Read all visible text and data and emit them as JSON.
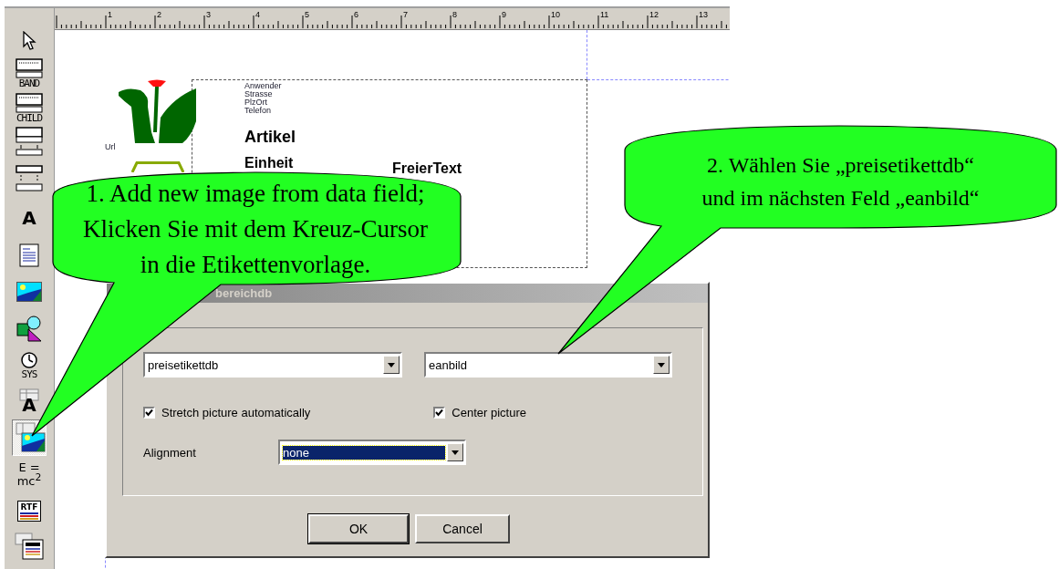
{
  "toolbar": {
    "items": [
      {
        "kind": "pointer",
        "selected": false
      },
      {
        "kind": "band",
        "label": "BAND",
        "selected": false
      },
      {
        "kind": "band",
        "label": "CHILD",
        "selected": false
      },
      {
        "kind": "band2",
        "selected": false
      },
      {
        "kind": "band3",
        "selected": false
      },
      {
        "kind": "text",
        "label": "A",
        "selected": false
      },
      {
        "kind": "memo",
        "selected": false
      },
      {
        "kind": "image",
        "selected": false
      },
      {
        "kind": "shape",
        "selected": false
      },
      {
        "kind": "sysdata",
        "label": "SYS",
        "selected": false
      },
      {
        "kind": "dbtext",
        "label": "A",
        "selected": false
      },
      {
        "kind": "dbimage",
        "selected": true
      },
      {
        "kind": "formula",
        "lines": [
          "E =",
          "mc$^{2}$"
        ],
        "selected": false
      },
      {
        "kind": "rtf",
        "label": "RTF",
        "selected": false
      },
      {
        "kind": "dbrtf",
        "selected": false
      }
    ]
  },
  "ruler": {
    "labels": [
      "1",
      "2",
      "3",
      "4",
      "5",
      "6",
      "7",
      "8",
      "9",
      "10",
      "11",
      "12",
      "13"
    ]
  },
  "label_template": {
    "address_lines": [
      "Anwender",
      "Strasse",
      "PlzOrt",
      "Telefon"
    ],
    "title": "Artikel",
    "url_label": "Url",
    "unit": "Einheit",
    "free_text": "FreierText"
  },
  "dialog": {
    "title": "bereichdb",
    "table_field": {
      "value": "preisetikettdb"
    },
    "field_field": {
      "value": "eanbild"
    },
    "options": [
      {
        "label": "Stretch picture automatically",
        "checked": true
      },
      {
        "label": "Center picture",
        "checked": true
      }
    ],
    "alignment": {
      "label": "Alignment",
      "value": "none",
      "highlighted": true
    },
    "buttons": [
      {
        "label": "OK",
        "default": true
      },
      {
        "label": "Cancel",
        "default": false
      }
    ]
  },
  "callouts": [
    {
      "lines": [
        "1. Add new image from data field;",
        "Klicken Sie mit dem Kreuz-Cursor",
        "in die Etikettenvorlage."
      ]
    },
    {
      "lines": [
        "2. Wählen Sie „preisetikettdb“",
        "und im nächsten Feld „eanbild“"
      ]
    }
  ]
}
